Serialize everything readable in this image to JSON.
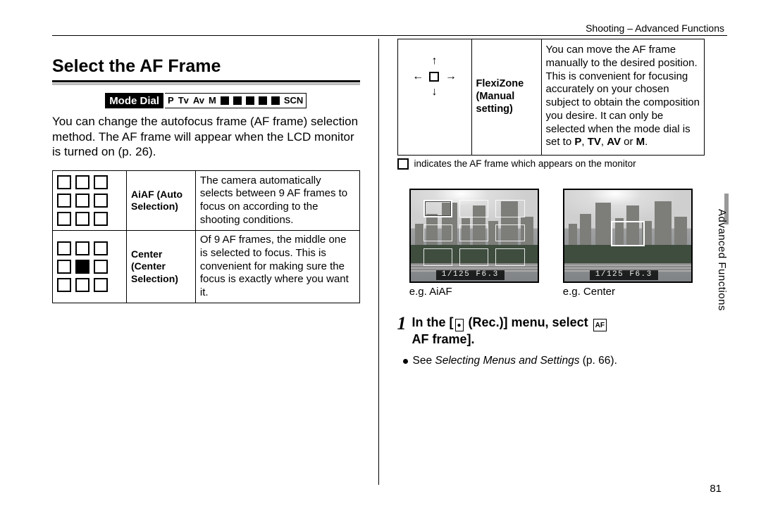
{
  "header": {
    "breadcrumb": "Shooting – Advanced Functions",
    "side_tab": "Advanced Functions",
    "page_number": "81"
  },
  "title": "Select the AF Frame",
  "mode_dial": {
    "label": "Mode Dial",
    "modes": [
      "P",
      "Tv",
      "Av",
      "M",
      "SCN"
    ]
  },
  "intro": "You can change the autofocus frame (AF frame) selection method. The AF frame will appear when the LCD monitor is turned on (p. 26).",
  "af_modes": [
    {
      "name": "AiAF (Auto Selection)",
      "desc": "The camera automatically selects between 9 AF frames to focus on according to the shooting conditions.",
      "selected_index": null
    },
    {
      "name": "Center (Center Selection)",
      "desc": "Of 9 AF frames, the middle one is selected to focus. This is convenient for making sure the focus is exactly where you want it.",
      "selected_index": 4
    }
  ],
  "flexizone": {
    "name": "FlexiZone (Manual setting)",
    "desc_parts": [
      "You can move the AF frame manually to the desired position. This is convenient for focusing accurately on your chosen subject to obtain the composition you desire. It can only be selected when the mode dial is set to ",
      "P",
      ", ",
      "TV",
      ", ",
      "AV",
      " or ",
      "M",
      "."
    ]
  },
  "footnote": "indicates the AF frame which appears on the monitor",
  "examples": {
    "osd": "1/125   F6.3",
    "left": "e.g. AiAF",
    "right": "e.g. Center"
  },
  "step": {
    "num": "1",
    "line_a": "In the [",
    "menu_icon_label": "●",
    "line_b": " (Rec.)] menu, select ",
    "af_icon_label": "AF",
    "line_c": " AF frame].",
    "sub_a": "See ",
    "sub_em": "Selecting Menus and Settings",
    "sub_b": " (p. 66)."
  }
}
